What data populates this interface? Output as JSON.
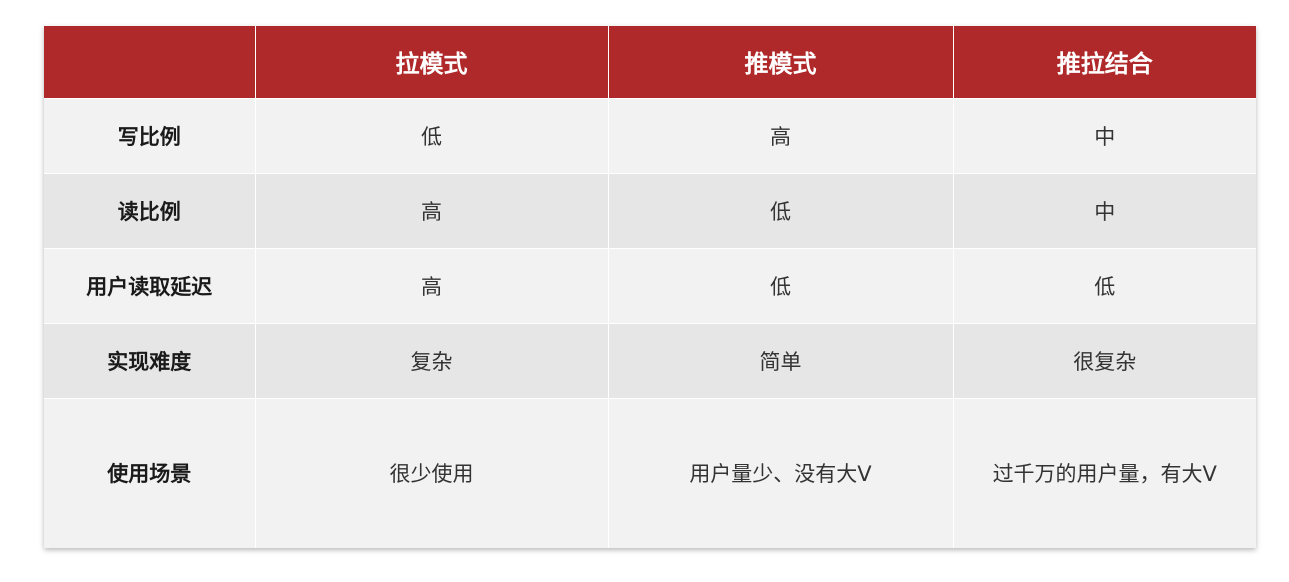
{
  "table": {
    "headers": [
      "",
      "拉模式",
      "推模式",
      "推拉结合"
    ],
    "rows": [
      {
        "label": "写比例",
        "cells": [
          "低",
          "高",
          "中"
        ]
      },
      {
        "label": "读比例",
        "cells": [
          "高",
          "低",
          "中"
        ]
      },
      {
        "label": "用户读取延迟",
        "cells": [
          "高",
          "低",
          "低"
        ]
      },
      {
        "label": "实现难度",
        "cells": [
          "复杂",
          "简单",
          "很复杂"
        ]
      },
      {
        "label": "使用场景",
        "cells": [
          "很少使用",
          "用户量少、没有大V",
          "过千万的用户量，有大V"
        ]
      }
    ]
  },
  "colors": {
    "header_bg": "#b0292a",
    "header_text": "#ffffff",
    "row_light": "#f2f2f2",
    "row_dark": "#e6e6e6"
  }
}
